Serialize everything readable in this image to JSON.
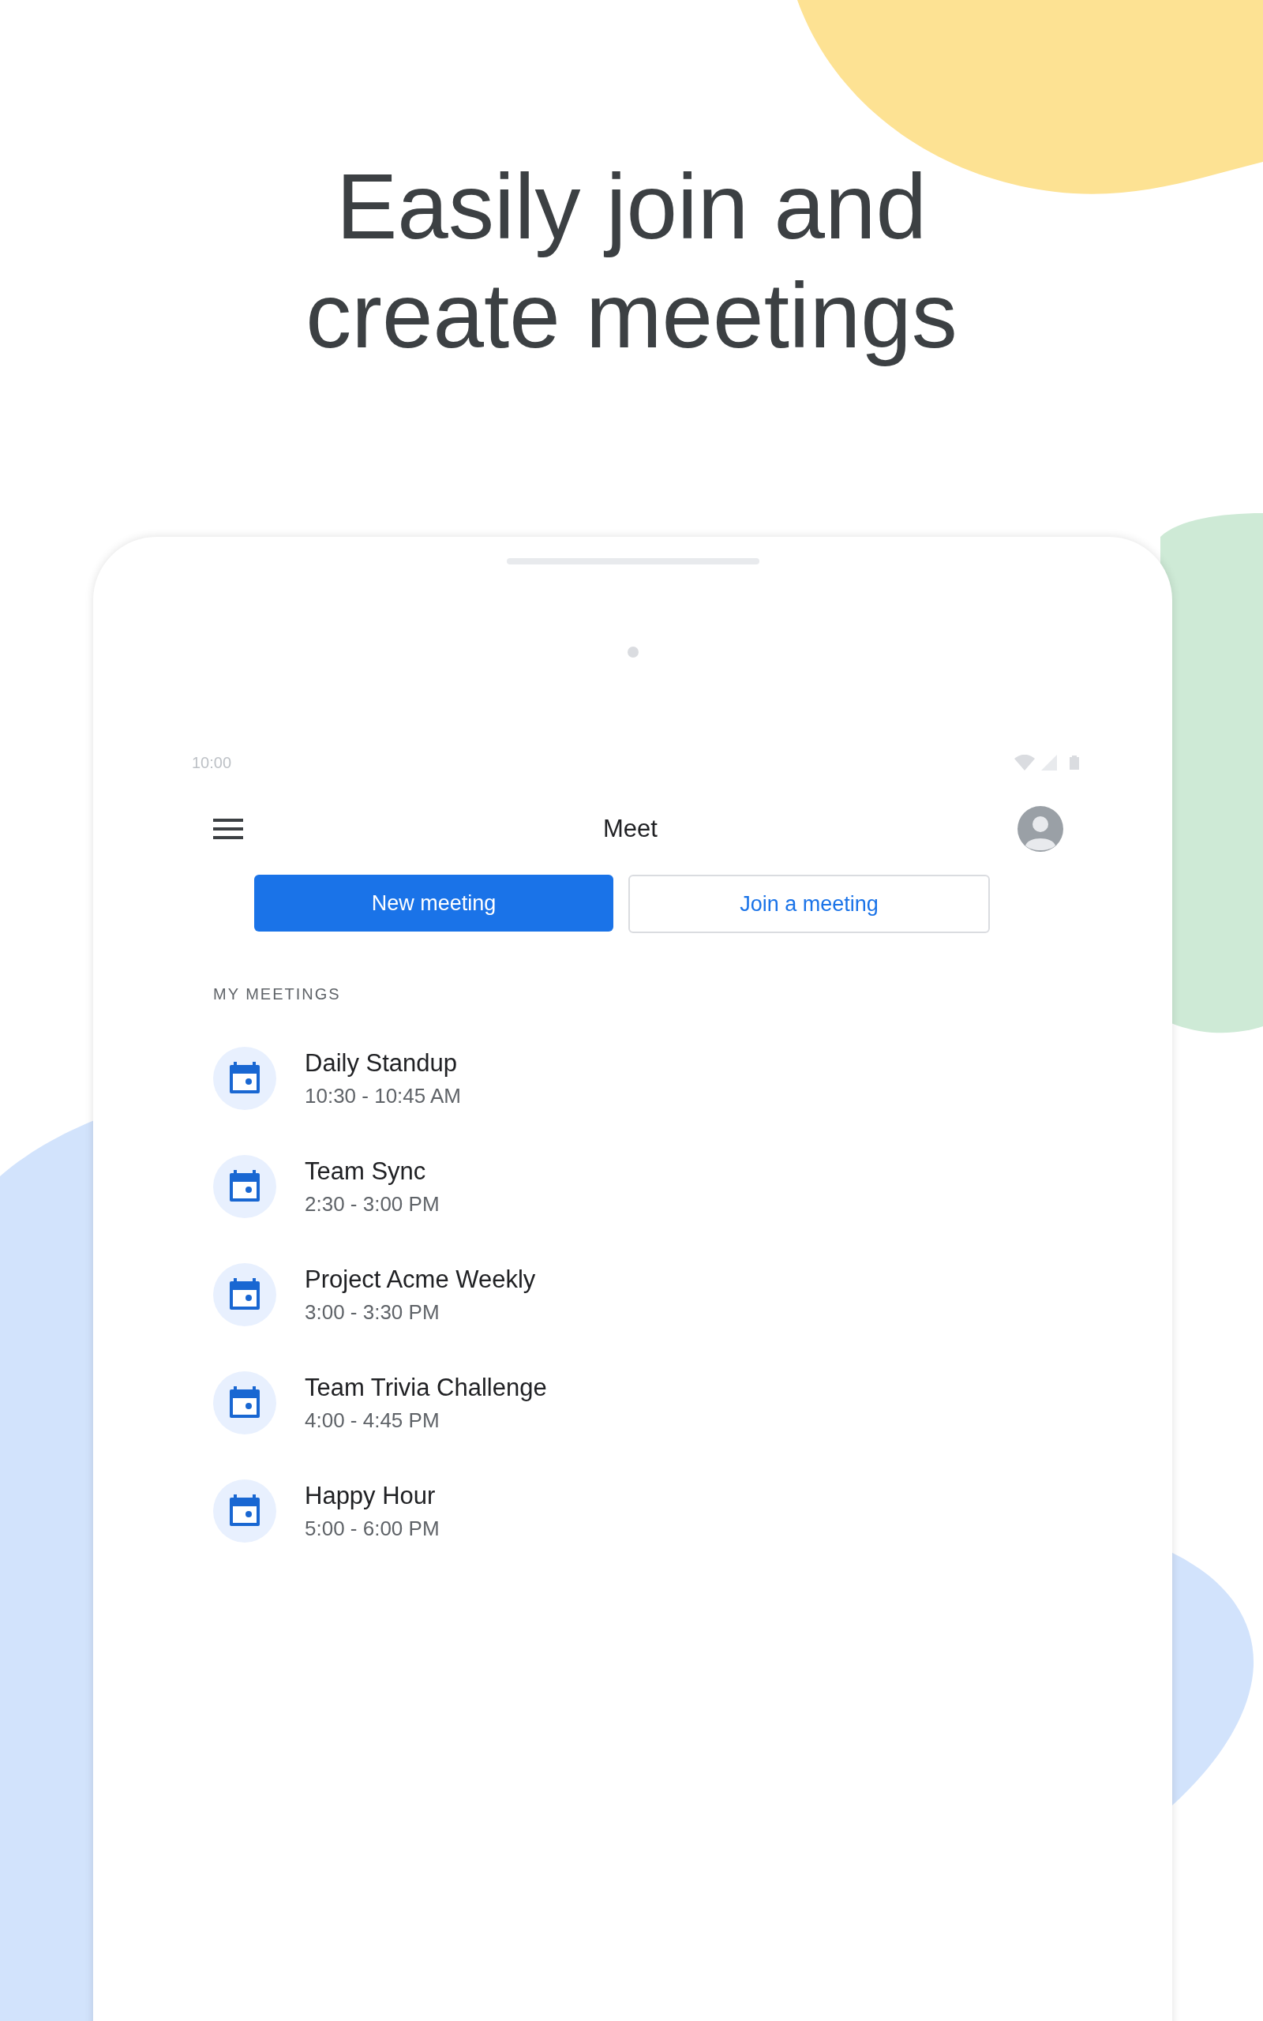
{
  "headline": "Easily join and create meetings",
  "status_bar": {
    "time": "10:00"
  },
  "app_bar": {
    "title": "Meet"
  },
  "buttons": [
    {
      "label": "New meeting",
      "kind": "primary"
    },
    {
      "label": "Join a meeting",
      "kind": "outlined"
    }
  ],
  "section_title": "MY MEETINGS",
  "meetings": [
    {
      "title": "Daily Standup",
      "time": "10:30 - 10:45 AM"
    },
    {
      "title": "Team Sync",
      "time": "2:30 - 3:00 PM"
    },
    {
      "title": "Project Acme Weekly",
      "time": "3:00 - 3:30 PM"
    },
    {
      "title": "Team Trivia Challenge",
      "time": "4:00 - 4:45 PM"
    },
    {
      "title": "Happy Hour",
      "time": "5:00 - 6:00 PM"
    }
  ]
}
